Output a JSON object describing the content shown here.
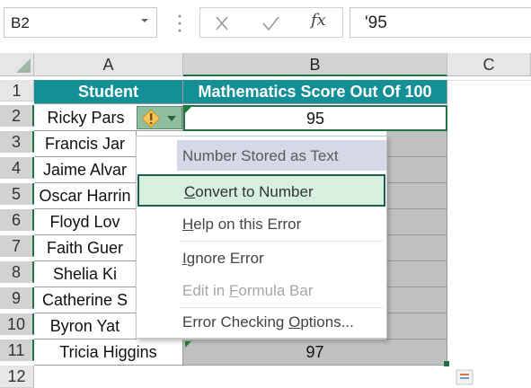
{
  "formula_bar": {
    "name_box": "B2",
    "cancel_icon": "close-icon",
    "enter_icon": "checkmark-icon",
    "fx_label": "fx",
    "formula_value": "'95"
  },
  "columns": [
    "A",
    "B",
    "C"
  ],
  "rows": [
    "1",
    "2",
    "3",
    "4",
    "5",
    "6",
    "7",
    "8",
    "9",
    "10",
    "11",
    "12"
  ],
  "table": {
    "headers": [
      "Student",
      "Mathematics Score Out Of 100"
    ],
    "names": [
      "Ricky Pars",
      "Francis Jar",
      "Jaime Alvar",
      "Oscar Harrin",
      "Floyd Lov",
      "Faith Guer",
      "Shelia Ki",
      "Catherine S",
      "Byron Yat",
      "Tricia Higgins"
    ],
    "scores": [
      "95",
      "",
      "",
      "",
      "",
      "",
      "",
      "",
      "",
      "97"
    ]
  },
  "error_menu": {
    "title": "Number Stored as Text",
    "items": [
      {
        "label": "Convert to Number",
        "mnemonic_index": 0,
        "highlighted": true,
        "enabled": true
      },
      {
        "label": "Help on this Error",
        "mnemonic_index": 0,
        "enabled": true
      },
      {
        "label": "Ignore Error",
        "mnemonic_index": 0,
        "enabled": true
      },
      {
        "label": "Edit in Formula Bar",
        "mnemonic_index": 8,
        "enabled": false
      },
      {
        "label": "Error Checking Options...",
        "mnemonic_index": 15,
        "enabled": true
      }
    ]
  },
  "colors": {
    "header_fill": "#138f95",
    "selection_green": "#217346",
    "menu_highlight": "#d6efdf",
    "menu_title_fill": "#d5d8e6",
    "score_fill": "#c0c0c0"
  }
}
